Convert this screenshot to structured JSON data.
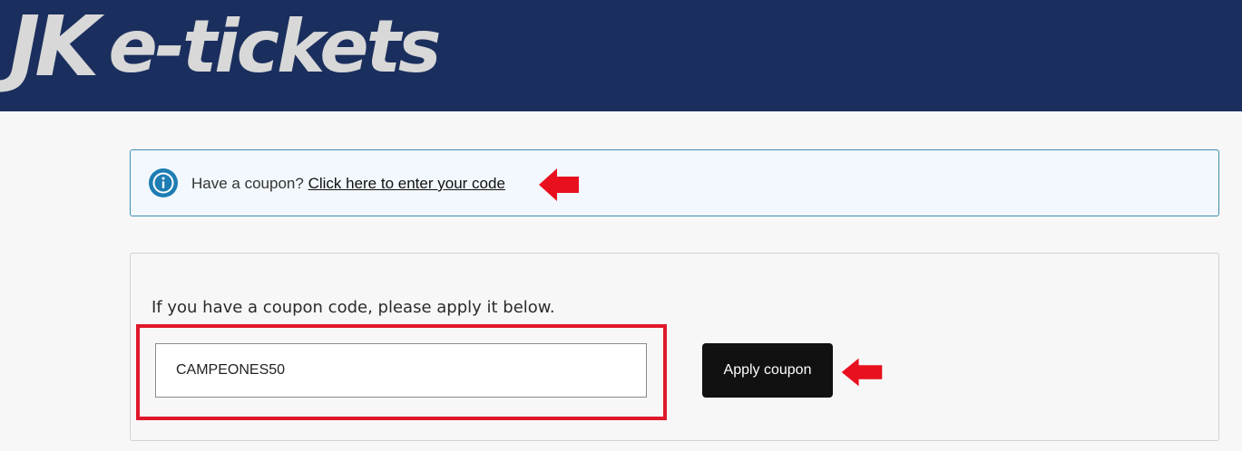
{
  "header": {
    "logo_mark": "JK",
    "logo_text": "e-tickets",
    "background_color": "#1b2f5e"
  },
  "notice": {
    "icon": "info-icon",
    "text": "Have a coupon?",
    "link": "Click here to enter your code"
  },
  "coupon_form": {
    "prompt": "If you have a coupon code, please apply it below.",
    "input_value": "CAMPEONES50",
    "apply_label": "Apply coupon"
  },
  "annotations": {
    "highlight_color": "#e0182b",
    "arrow_icon": "left-arrow-icon"
  }
}
